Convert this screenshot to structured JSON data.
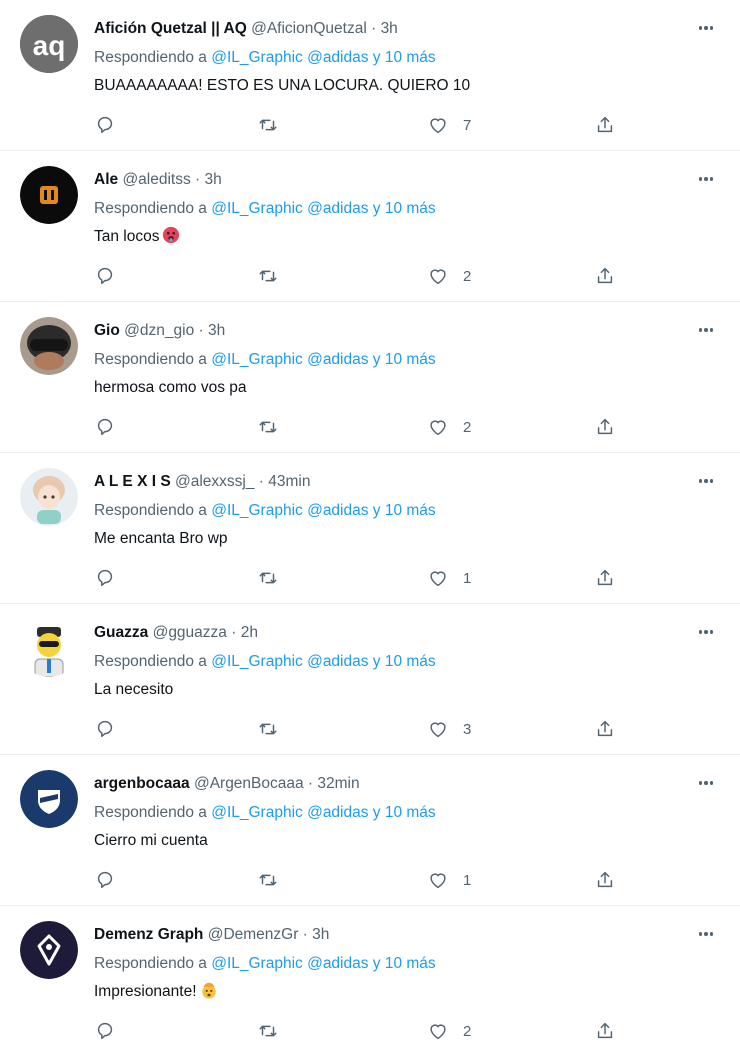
{
  "reply_label": "Respondiendo a",
  "mention_text": "@IL_Graphic @adidas y 10 más",
  "tweets": [
    {
      "name": "Afición Quetzal || AQ",
      "handle": "@AficionQuetzal",
      "time": "3h",
      "text": "BUAAAAAAAA! ESTO ES UNA LOCURA. QUIERO 10",
      "likes": "7",
      "avatar": "aq-logo"
    },
    {
      "name": "Ale",
      "handle": "@aleditss",
      "time": "3h",
      "text": "Tan locos",
      "likes": "2",
      "avatar": "dark-logo",
      "emoji": "hot-face"
    },
    {
      "name": "Gio",
      "handle": "@dzn_gio",
      "time": "3h",
      "text": "hermosa como vos pa",
      "likes": "2",
      "avatar": "helmet-photo"
    },
    {
      "name": "A L E X I S",
      "handle": "@alexxssj_",
      "time": "43min",
      "text": "Me encanta Bro wp",
      "likes": "1",
      "avatar": "anime-character"
    },
    {
      "name": "Guazza",
      "handle": "@gguazza",
      "time": "2h",
      "text": "La necesito",
      "likes": "3",
      "avatar": "cartoon-character"
    },
    {
      "name": "argenbocaaa",
      "handle": "@ArgenBocaaa",
      "time": "32min",
      "text": "Cierro mi cuenta",
      "likes": "1",
      "avatar": "boca-shield"
    },
    {
      "name": "Demenz Graph",
      "handle": "@DemenzGr",
      "time": "3h",
      "text": "Impresionante!",
      "likes": "2",
      "avatar": "demenz-logo",
      "emoji": "exploding-head"
    }
  ],
  "colors": {
    "accent": "#1d9bf0",
    "text": "#0f1419",
    "muted": "#536471",
    "divider": "#e6ecf0"
  }
}
